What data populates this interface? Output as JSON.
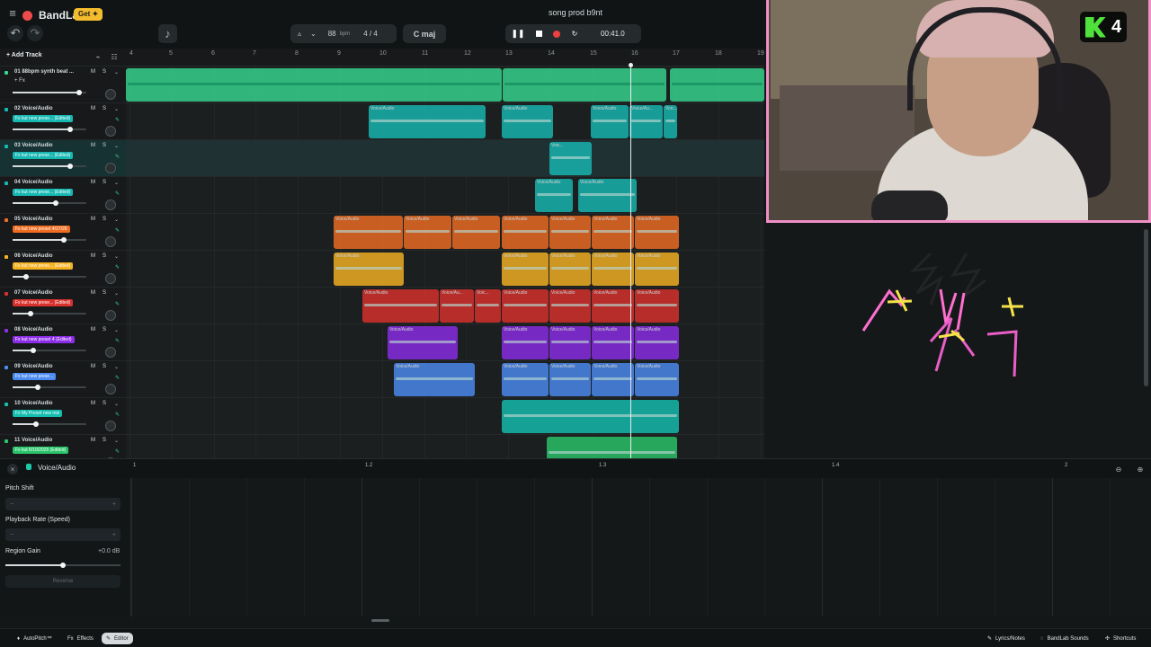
{
  "header": {
    "brand": "BandLab",
    "get_label": "Get",
    "song_title": "song prod b9nt",
    "bpm": "88",
    "bpm_unit": "bpm",
    "time_signature": "4 / 4",
    "key": "C maj",
    "time": "00:41.0"
  },
  "timeline": {
    "add_track": "Add Track",
    "ruler": [
      "4",
      "5",
      "6",
      "7",
      "8",
      "9",
      "10",
      "11",
      "12",
      "13",
      "14",
      "15",
      "16",
      "17",
      "18",
      "19"
    ]
  },
  "tracks": [
    {
      "name": "01  88bpm synth beat ...",
      "fx": "+ Fx",
      "tag": "",
      "color": "#37d78f",
      "volume": 0.9,
      "selected": false
    },
    {
      "name": "02  Voice/Audio",
      "tag": "Fx kut new prese...  (Edited)",
      "color": "#17b8b2",
      "volume": 0.78,
      "selected": false
    },
    {
      "name": "03  Voice/Audio",
      "tag": "Fx kut new prese...  (Edited)",
      "color": "#17b8b2",
      "volume": 0.78,
      "selected": true
    },
    {
      "name": "04  Voice/Audio",
      "tag": "Fx kut new prese...  (Edited)",
      "color": "#17b8b2",
      "volume": 0.58,
      "selected": false
    },
    {
      "name": "05  Voice/Audio",
      "tag": "Fx kut new preset 4/17/26",
      "color": "#ef6d22",
      "volume": 0.7,
      "selected": false
    },
    {
      "name": "06  Voice/Audio",
      "tag": "Fx kut new prese...  (Edited)",
      "color": "#f4b223",
      "volume": 0.18,
      "selected": false
    },
    {
      "name": "07  Voice/Audio",
      "tag": "Fx kut new prese...  (Edited)",
      "color": "#d8312d",
      "volume": 0.24,
      "selected": false
    },
    {
      "name": "08  Voice/Audio",
      "tag": "Fx kut new preset 4 (Edited)",
      "color": "#8c2de7",
      "volume": 0.28,
      "selected": false
    },
    {
      "name": "09  Voice/Audio",
      "tag": "Fx kut new prese...",
      "color": "#4c8bf2",
      "volume": 0.34,
      "selected": false
    },
    {
      "name": "10  Voice/Audio",
      "tag": "Fx My Preset new mix",
      "color": "#14beb0",
      "volume": 0.32,
      "selected": false
    },
    {
      "name": "11  Voice/Audio",
      "tag": "Fx kut 6/10/2025 (Edited)",
      "color": "#2ac56a",
      "volume": 0.52,
      "selected": false
    }
  ],
  "clips": {
    "voice_label": "Voice/Audio",
    "voice_short": "Voice/Au...",
    "voice_tiny": "Voic..."
  },
  "editor": {
    "title": "Voice/Audio",
    "ruler": [
      "1",
      "1.2",
      "1.3",
      "1.4",
      "2"
    ],
    "pitch_label": "Pitch Shift",
    "playback_label": "Playback Rate (Speed)",
    "region_gain_label": "Region Gain",
    "region_gain_value": "+0.0 dB",
    "reverse_label": "Reverse"
  },
  "footer": {
    "autopitch": "AutoPitch™",
    "effects": "Effects",
    "editor": "Editor",
    "lyrics": "Lyrics/Notes",
    "sounds": "BandLab Sounds",
    "shortcuts": "Shortcuts"
  },
  "overlay": {
    "channel_number": "4"
  },
  "colors": {
    "background": "#141718",
    "panel": "#111415",
    "accent_green": "#37d78f",
    "teal": "#17b8b2",
    "orange": "#ef6d22",
    "yellow": "#f4b223",
    "red": "#d8312d",
    "purple": "#8c2de7",
    "blue": "#4c8bf2",
    "webcam_border": "#ef8fc6"
  }
}
